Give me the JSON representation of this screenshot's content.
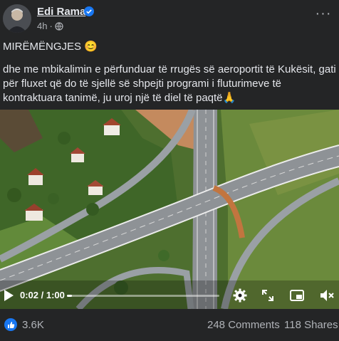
{
  "post": {
    "author": "Edi Rama",
    "time": "4h",
    "headline": "MIRËMËNGJES 😊",
    "body": "dhe me mbikalimin e përfunduar të rrugës së aeroportit të Kukësit, gati për fluxet që do të sjellë së shpejti programi i fluturimeve të kontraktuara tanimë, ju uroj një të diel të paqtë🙏"
  },
  "video": {
    "time_display": "0:02 / 1:00",
    "progress": 0.033
  },
  "stats": {
    "reactions": "3.6K",
    "comments": "248 Comments",
    "shares": "118 Shares"
  },
  "colors": {
    "background": "#242526",
    "text": "#e4e6eb",
    "secondary_text": "#b0b3b8",
    "brand_blue": "#1877f2"
  },
  "icons": [
    "verified-badge-icon",
    "globe-icon",
    "more-options-icon",
    "play-icon",
    "settings-icon",
    "fullscreen-icon",
    "miniplayer-icon",
    "volume-muted-icon",
    "like-icon"
  ]
}
